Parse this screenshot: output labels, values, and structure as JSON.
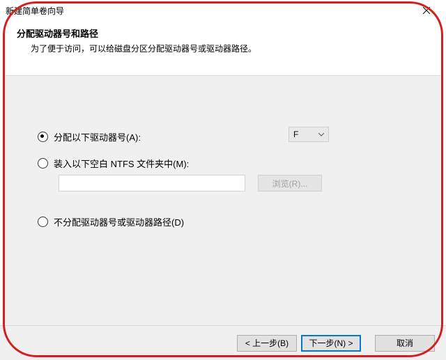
{
  "window": {
    "title": "新建简单卷向导"
  },
  "header": {
    "title": "分配驱动器号和路径",
    "description": "为了便于访问，可以给磁盘分区分配驱动器号或驱动器路径。"
  },
  "options": {
    "assign_letter": {
      "label": "分配以下驱动器号(A):",
      "selected_letter": "F",
      "checked": true
    },
    "mount_folder": {
      "label": "装入以下空白 NTFS 文件夹中(M):",
      "path_value": "",
      "browse_label": "浏览(R)...",
      "checked": false
    },
    "no_assign": {
      "label": "不分配驱动器号或驱动器路径(D)",
      "checked": false
    }
  },
  "footer": {
    "back": "< 上一步(B)",
    "next": "下一步(N) >",
    "cancel": "取消"
  }
}
